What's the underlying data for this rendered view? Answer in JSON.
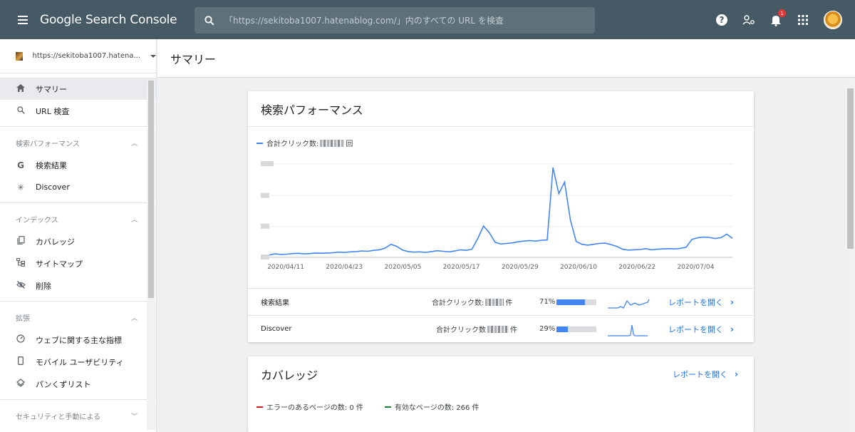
{
  "app": {
    "title": "Google Search Console"
  },
  "search": {
    "placeholder": "「https://sekitoba1007.hatenablog.com/」内のすべての URL を検査"
  },
  "notifications": {
    "count": "1"
  },
  "sidebar": {
    "property": "https://sekitoba1007.hatena...",
    "items": [
      {
        "label": "サマリー",
        "icon": "home-icon"
      },
      {
        "label": "URL 検査",
        "icon": "search-icon"
      }
    ],
    "sections": [
      {
        "title": "検索パフォーマンス",
        "items": [
          {
            "label": "検索結果",
            "icon": "google-g-icon"
          },
          {
            "label": "Discover",
            "icon": "asterisk-icon"
          }
        ]
      },
      {
        "title": "インデックス",
        "items": [
          {
            "label": "カバレッジ",
            "icon": "coverage-icon"
          },
          {
            "label": "サイトマップ",
            "icon": "sitemap-icon"
          },
          {
            "label": "削除",
            "icon": "eye-off-icon"
          }
        ]
      },
      {
        "title": "拡張",
        "items": [
          {
            "label": "ウェブに関する主な指標",
            "icon": "speedometer-icon"
          },
          {
            "label": "モバイル ユーザビリティ",
            "icon": "phone-icon"
          },
          {
            "label": "パンくずリスト",
            "icon": "layers-icon"
          }
        ]
      },
      {
        "title": "セキュリティと手動による"
      }
    ]
  },
  "header": {
    "title": "サマリー"
  },
  "performance": {
    "title": "検索パフォーマンス",
    "legend_label": "合計クリック数:",
    "legend_suffix": "回",
    "rows": [
      {
        "label": "検索結果",
        "metric_label": "合計クリック数:",
        "metric_suffix": "件",
        "percent": "71%",
        "percent_value": 0.71,
        "link": "レポートを開く"
      },
      {
        "label": "Discover",
        "metric_label": "合計クリック数",
        "metric_suffix": "件",
        "percent": "29%",
        "percent_value": 0.29,
        "link": "レポートを開く"
      }
    ]
  },
  "coverage": {
    "title": "カバレッジ",
    "link": "レポートを開く",
    "errors_label": "エラーのあるページの数: 0 件",
    "valid_label": "有効なページの数: 266 件",
    "error_color": "#c5221f",
    "valid_color": "#188038"
  },
  "chart_data": {
    "type": "line",
    "x_tick_labels": [
      "2020/04/11",
      "2020/04/23",
      "2020/05/05",
      "2020/05/17",
      "2020/05/29",
      "2020/06/10",
      "2020/06/22",
      "2020/07/04"
    ],
    "y_tick_labels": [],
    "series": [
      {
        "color": "#4285f4",
        "values": [
          0.8,
          1.2,
          1.0,
          1.1,
          1.3,
          1.4,
          1.2,
          1.3,
          1.5,
          1.4,
          1.5,
          1.6,
          1.8,
          1.7,
          1.9,
          2.0,
          2.2,
          2.1,
          2.4,
          2.6,
          3.2,
          4.5,
          3.8,
          2.5,
          2.0,
          1.8,
          1.9,
          1.7,
          2.0,
          2.3,
          2.1,
          1.9,
          2.2,
          2.6,
          2.4,
          2.8,
          6.5,
          10.8,
          8.5,
          5.2,
          4.6,
          4.8,
          5.0,
          5.4,
          5.6,
          5.8,
          5.6,
          5.9,
          6.0,
          31.0,
          22.0,
          26.0,
          13.0,
          5.5,
          4.5,
          4.2,
          4.5,
          4.8,
          4.9,
          4.4,
          3.8,
          2.8,
          2.5,
          2.6,
          2.7,
          3.0,
          2.6,
          2.8,
          2.9,
          3.0,
          2.9,
          3.1,
          3.5,
          6.2,
          6.8,
          7.0,
          6.9,
          6.5,
          6.8,
          8.0,
          6.6
        ]
      }
    ]
  }
}
